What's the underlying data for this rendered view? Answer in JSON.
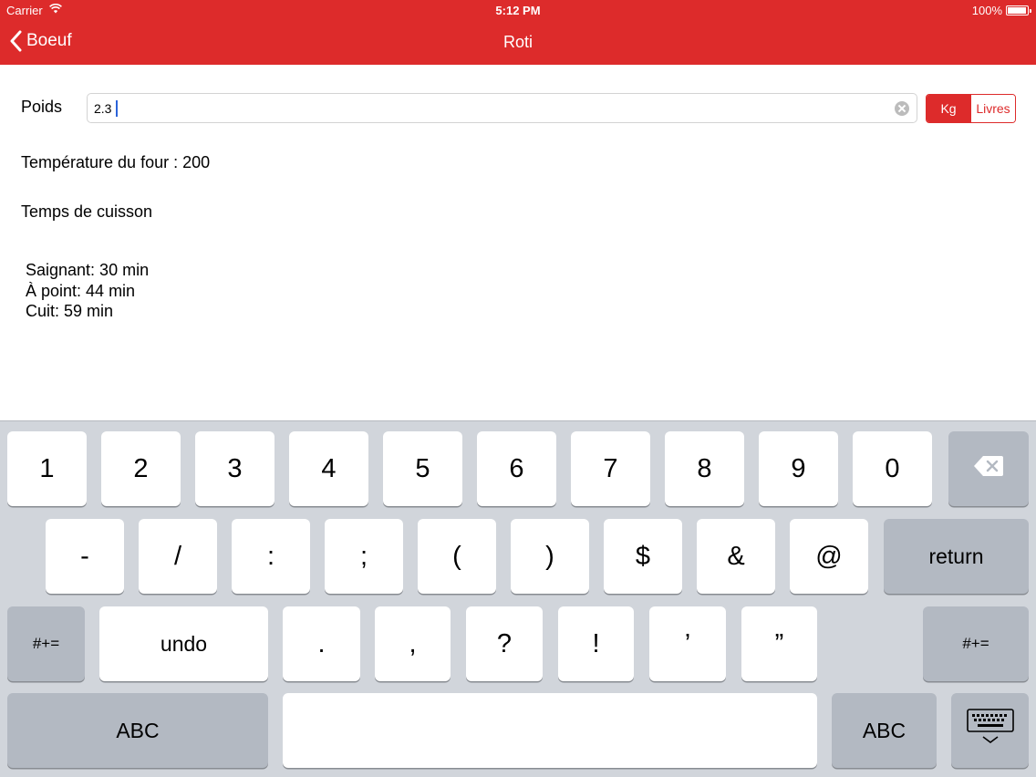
{
  "status_bar": {
    "carrier": "Carrier",
    "time": "5:12 PM",
    "battery": "100%",
    "battery_level": 1.0
  },
  "nav": {
    "back_label": "Boeuf",
    "title": "Roti"
  },
  "form": {
    "weight_label": "Poids",
    "weight_value": "2.3",
    "unit_options": [
      "Kg",
      "Livres"
    ],
    "unit_selected": "Kg"
  },
  "info": {
    "temperature": "Température du four : 200",
    "cooking_title": "Temps de cuisson",
    "cooking_lines": [
      "Saignant: 30 min",
      "À point: 44 min",
      "Cuit: 59 min"
    ]
  },
  "keyboard": {
    "row1": [
      "1",
      "2",
      "3",
      "4",
      "5",
      "6",
      "7",
      "8",
      "9",
      "0"
    ],
    "row2": [
      "-",
      "/",
      ":",
      ";",
      "(",
      ")",
      "$",
      "&",
      "@"
    ],
    "return_label": "return",
    "row3_left": "#+=",
    "undo_label": "undo",
    "row3": [
      ".",
      ",",
      "?",
      "!",
      "’",
      "”"
    ],
    "row3_right": "#+=",
    "abc_left": "ABC",
    "abc_right": "ABC"
  },
  "colors": {
    "accent": "#dd2b2b",
    "keyboard_bg": "#d1d5db",
    "key_dark": "#b3b9c2"
  },
  "icons": [
    "chevron-left-icon",
    "wifi-icon",
    "battery-icon",
    "clear-icon",
    "backspace-icon",
    "keyboard-dismiss-icon"
  ]
}
